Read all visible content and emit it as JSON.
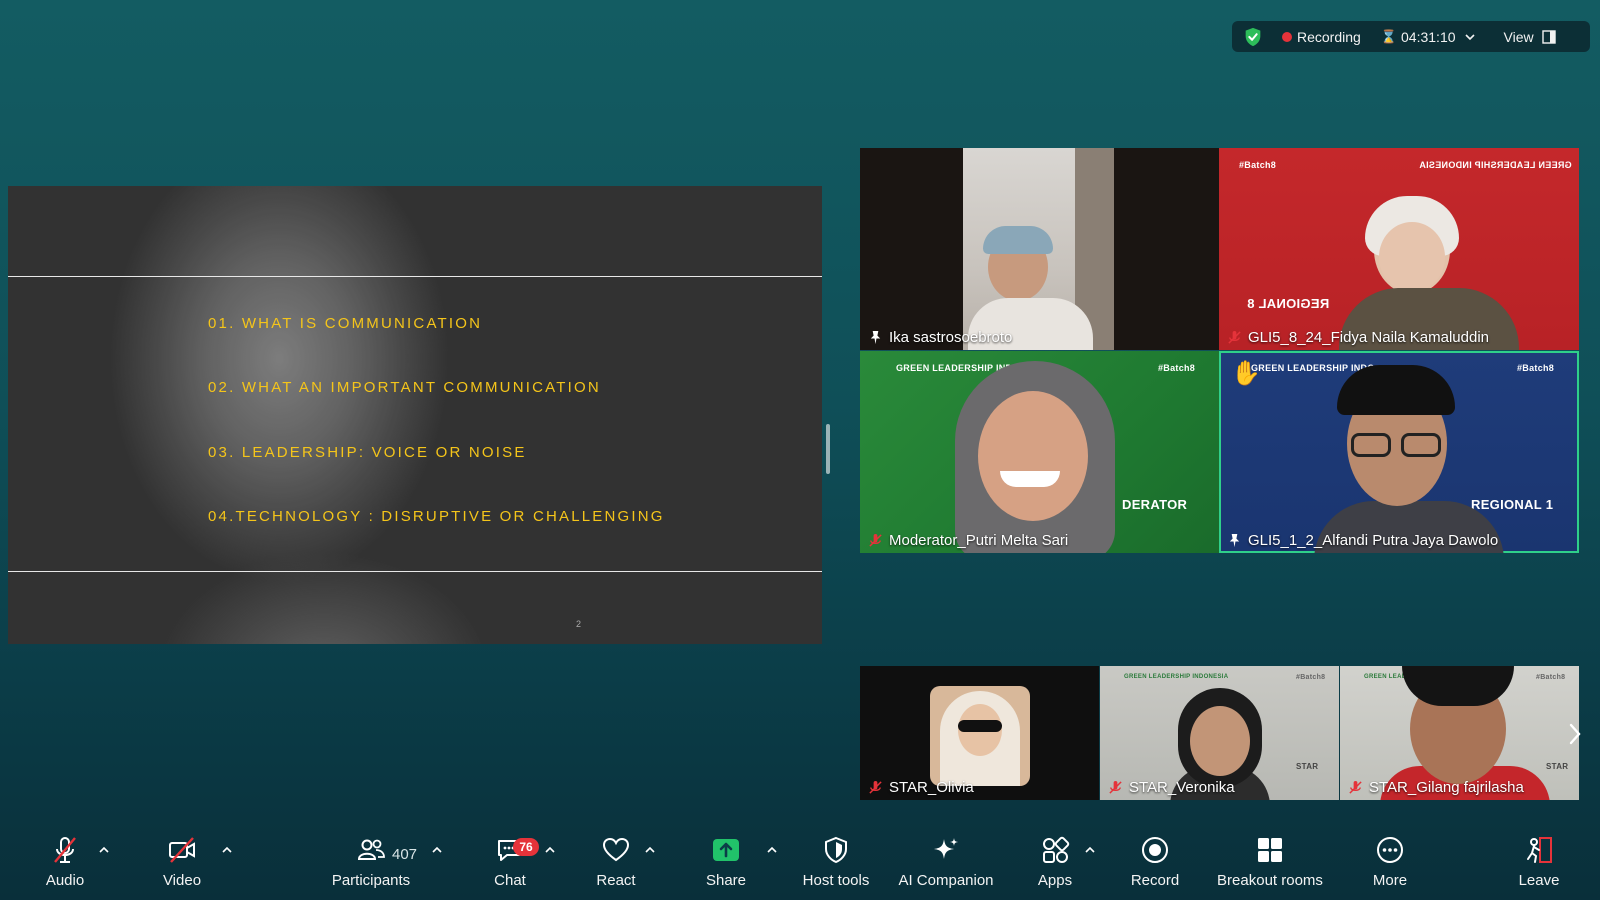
{
  "topbar": {
    "recording_label": "Recording",
    "timer": "04:31:10",
    "view_label": "View",
    "colors": {
      "secure": "#2dbd5a",
      "recording_dot": "#e5333a"
    }
  },
  "slide": {
    "items": [
      "01. WHAT IS COMMUNICATION",
      "02. WHAT AN IMPORTANT COMMUNICATION",
      "03. LEADERSHIP: VOICE OR NOISE",
      "04.TECHNOLOGY : DISRUPTIVE OR CHALLENGING"
    ],
    "page_number": "2",
    "accent_color": "#f5c51a"
  },
  "gallery": [
    {
      "name": "Ika sastrosoebroto",
      "mic": "pinned"
    },
    {
      "name": "GLI5_8_24_Fidya Naila Kamaluddin",
      "mic": "muted",
      "banner_left": "#Batch8",
      "banner_right": "GREEN LEADERSHIP INDONESIA",
      "region": "REGIONAL 8"
    },
    {
      "name": "Moderator_Putri Melta Sari",
      "mic": "muted",
      "banner_left": "GREEN LEADERSHIP INDO",
      "banner_right": "#Batch8",
      "region": "DERATOR"
    },
    {
      "name": "GLI5_1_2_Alfandi Putra Jaya Dawolo",
      "mic": "pinned",
      "banner_left": "GREEN LEADERSHIP INDO",
      "banner_right": "#Batch8",
      "region": "REGIONAL 1",
      "hand_raised": true,
      "active_speaker": true
    }
  ],
  "strip": [
    {
      "name": "STAR_Olivia",
      "mic": "muted"
    },
    {
      "name": "STAR_Veronika",
      "mic": "muted",
      "banner_left": "GREEN LEADERSHIP INDONESIA",
      "banner_right": "#Batch8",
      "tag": "STAR"
    },
    {
      "name": "STAR_Gilang fajrilasha",
      "mic": "muted",
      "banner_left": "GREEN LEADERSHIP",
      "banner_right": "#Batch8",
      "tag": "STAR"
    }
  ],
  "toolbar": {
    "audio": "Audio",
    "video": "Video",
    "participants": "Participants",
    "participants_count": "407",
    "chat": "Chat",
    "chat_badge": "76",
    "react": "React",
    "share": "Share",
    "host_tools": "Host tools",
    "ai_companion": "AI Companion",
    "apps": "Apps",
    "record": "Record",
    "breakout_rooms": "Breakout rooms",
    "more": "More",
    "leave": "Leave",
    "share_color": "#21c26a",
    "muted_color": "#e5333a"
  }
}
